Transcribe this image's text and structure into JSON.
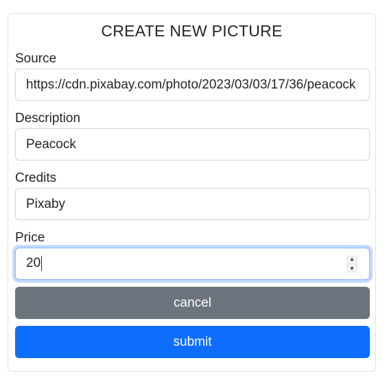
{
  "form": {
    "title": "CREATE NEW PICTURE",
    "fields": {
      "source": {
        "label": "Source",
        "value": "https://cdn.pixabay.com/photo/2023/03/03/17/36/peacock"
      },
      "description": {
        "label": "Description",
        "value": "Peacock"
      },
      "credits": {
        "label": "Credits",
        "value": "Pixaby"
      },
      "price": {
        "label": "Price",
        "value": "20"
      }
    },
    "buttons": {
      "cancel": "cancel",
      "submit": "submit"
    }
  },
  "colors": {
    "cancel_bg": "#6c757d",
    "submit_bg": "#0d6efd",
    "focus_border": "#86b7fe"
  },
  "icons": {
    "spinner_up": "triangle-up-icon",
    "spinner_down": "triangle-down-icon"
  }
}
